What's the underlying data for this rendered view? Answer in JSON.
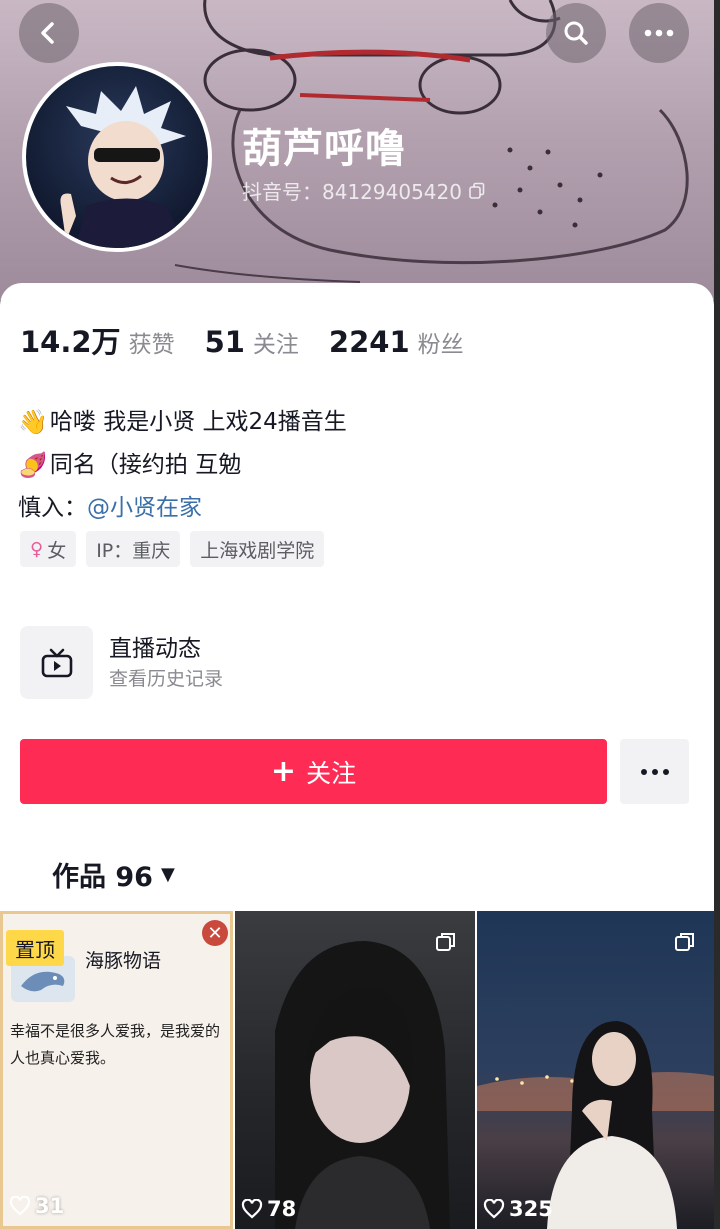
{
  "header": {
    "nickname": "葫芦呼噜",
    "douyin_id": "抖音号：84129405420"
  },
  "stats": [
    {
      "value": "14.2万",
      "label": "获赞"
    },
    {
      "value": "51",
      "label": "关注"
    },
    {
      "value": "2241",
      "label": "粉丝"
    }
  ],
  "bio": {
    "line1_emoji": "👋",
    "line1_text": "哈喽 我是小贤 上戏24播音生",
    "line2_emoji": "🍠",
    "line2_text": "同名（接约拍 互勉",
    "line3_prefix": "慎入：",
    "line3_mention": "@小贤在家"
  },
  "tags": {
    "gender_symbol": "♀",
    "gender": "女",
    "ip": "IP：重庆",
    "school": "上海戏剧学院"
  },
  "live": {
    "title": "直播动态",
    "subtitle": "查看历史记录"
  },
  "actions": {
    "follow_label": "关注",
    "follow_plus": "+"
  },
  "works_tab": {
    "label": "作品 96",
    "caret": "▼"
  },
  "grid": [
    {
      "pinned_label": "置顶",
      "note_title": "海豚物语",
      "note_body": "幸福不是很多人爱我，是我爱的人也真心爱我。",
      "likes": "31"
    },
    {
      "likes": "78"
    },
    {
      "likes": "325"
    }
  ],
  "colors": {
    "accent": "#fe2c55",
    "mention": "#3a6fa8",
    "pin_badge": "#ffd84a"
  }
}
